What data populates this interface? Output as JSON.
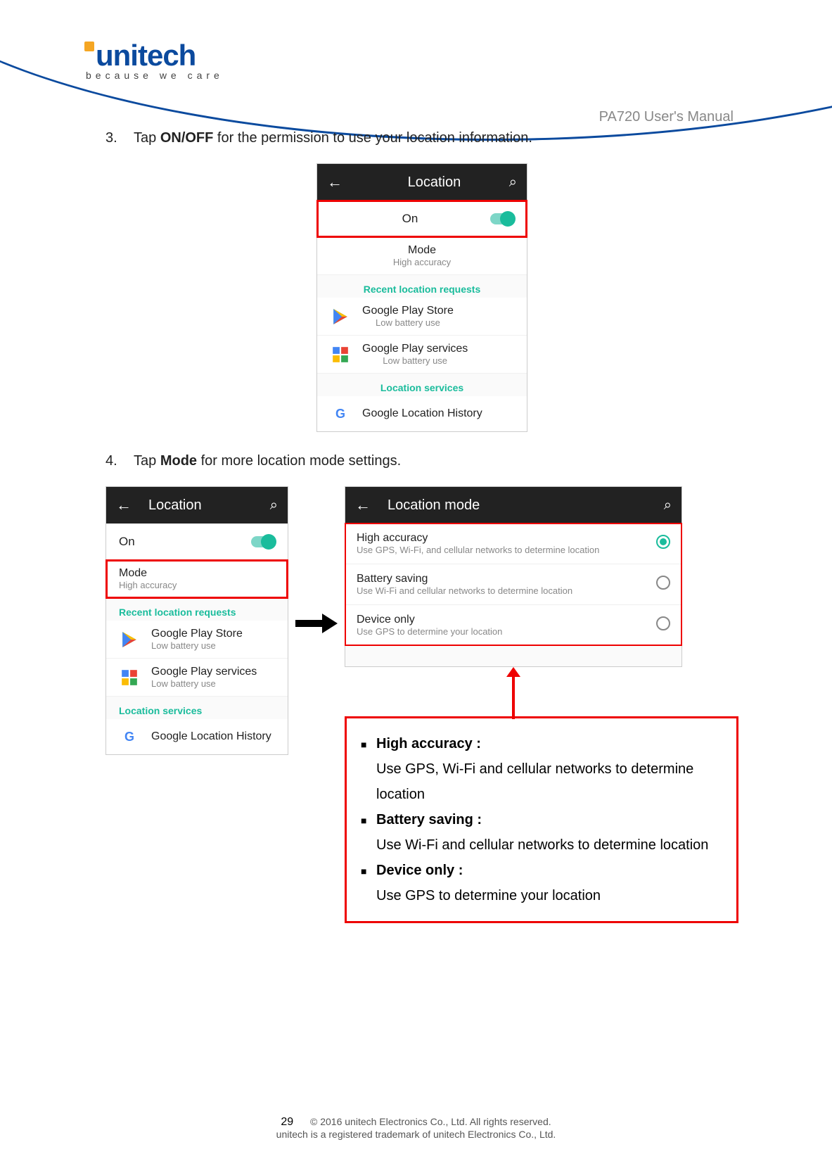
{
  "header": {
    "logo_text": "unitech",
    "tagline": "because we care",
    "manual_title": "PA720 User's Manual"
  },
  "steps": {
    "s3": {
      "num": "3.",
      "pre": "Tap ",
      "bold": "ON/OFF",
      "post": " for the permission to use your location information."
    },
    "s4": {
      "num": "4.",
      "pre": "Tap ",
      "bold": "Mode",
      "post": " for more location mode settings."
    }
  },
  "shot1": {
    "title": "Location",
    "toggle_label": "On",
    "mode_title": "Mode",
    "mode_value": "High accuracy",
    "section_recent": "Recent location requests",
    "apps": [
      {
        "name": "Google Play Store",
        "sub": "Low battery use"
      },
      {
        "name": "Google Play services",
        "sub": "Low battery use"
      }
    ],
    "section_services": "Location services",
    "history": "Google Location History"
  },
  "shot2": {
    "title": "Location",
    "toggle_label": "On",
    "mode_title": "Mode",
    "mode_value": "High accuracy",
    "section_recent": "Recent location requests",
    "apps": [
      {
        "name": "Google Play Store",
        "sub": "Low battery use"
      },
      {
        "name": "Google Play services",
        "sub": "Low battery use"
      }
    ],
    "section_services": "Location services",
    "history": "Google Location History"
  },
  "shot3": {
    "title": "Location mode",
    "options": [
      {
        "name": "High accuracy",
        "sub": "Use GPS, Wi-Fi, and cellular networks to determine location",
        "selected": true
      },
      {
        "name": "Battery saving",
        "sub": "Use Wi-Fi and cellular networks to determine location",
        "selected": false
      },
      {
        "name": "Device only",
        "sub": "Use GPS to determine your location",
        "selected": false
      }
    ]
  },
  "descriptions": [
    {
      "title": "High accuracy :",
      "body": "Use GPS, Wi-Fi and cellular networks to determine location"
    },
    {
      "title": "Battery saving :",
      "body": "Use Wi-Fi and cellular networks to determine location"
    },
    {
      "title": "Device only :",
      "body": "Use GPS to determine your location"
    }
  ],
  "footer": {
    "page": "29",
    "line1": "© 2016 unitech Electronics Co., Ltd. All rights reserved.",
    "line2": "unitech is a registered trademark of unitech Electronics Co., Ltd."
  }
}
